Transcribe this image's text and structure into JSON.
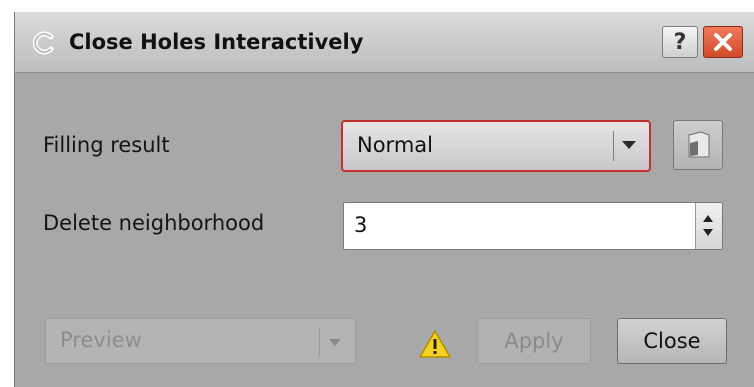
{
  "window": {
    "title": "Close Holes Interactively",
    "help_label": "?",
    "close_icon": "close-x-icon"
  },
  "form": {
    "filling_result": {
      "label": "Filling result",
      "selected": "Normal"
    },
    "delete_neighborhood": {
      "label": "Delete neighborhood",
      "value": "3"
    }
  },
  "footer": {
    "preview": {
      "label": "Preview",
      "enabled": false
    },
    "warning_icon": "warning-icon",
    "apply_label": "Apply",
    "close_label": "Close"
  },
  "colors": {
    "dialog_bg": "#a8a8a8",
    "combo_focus_border": "#c33030",
    "close_x_red": "#d24a2a",
    "warning_yellow": "#f5d21f"
  }
}
